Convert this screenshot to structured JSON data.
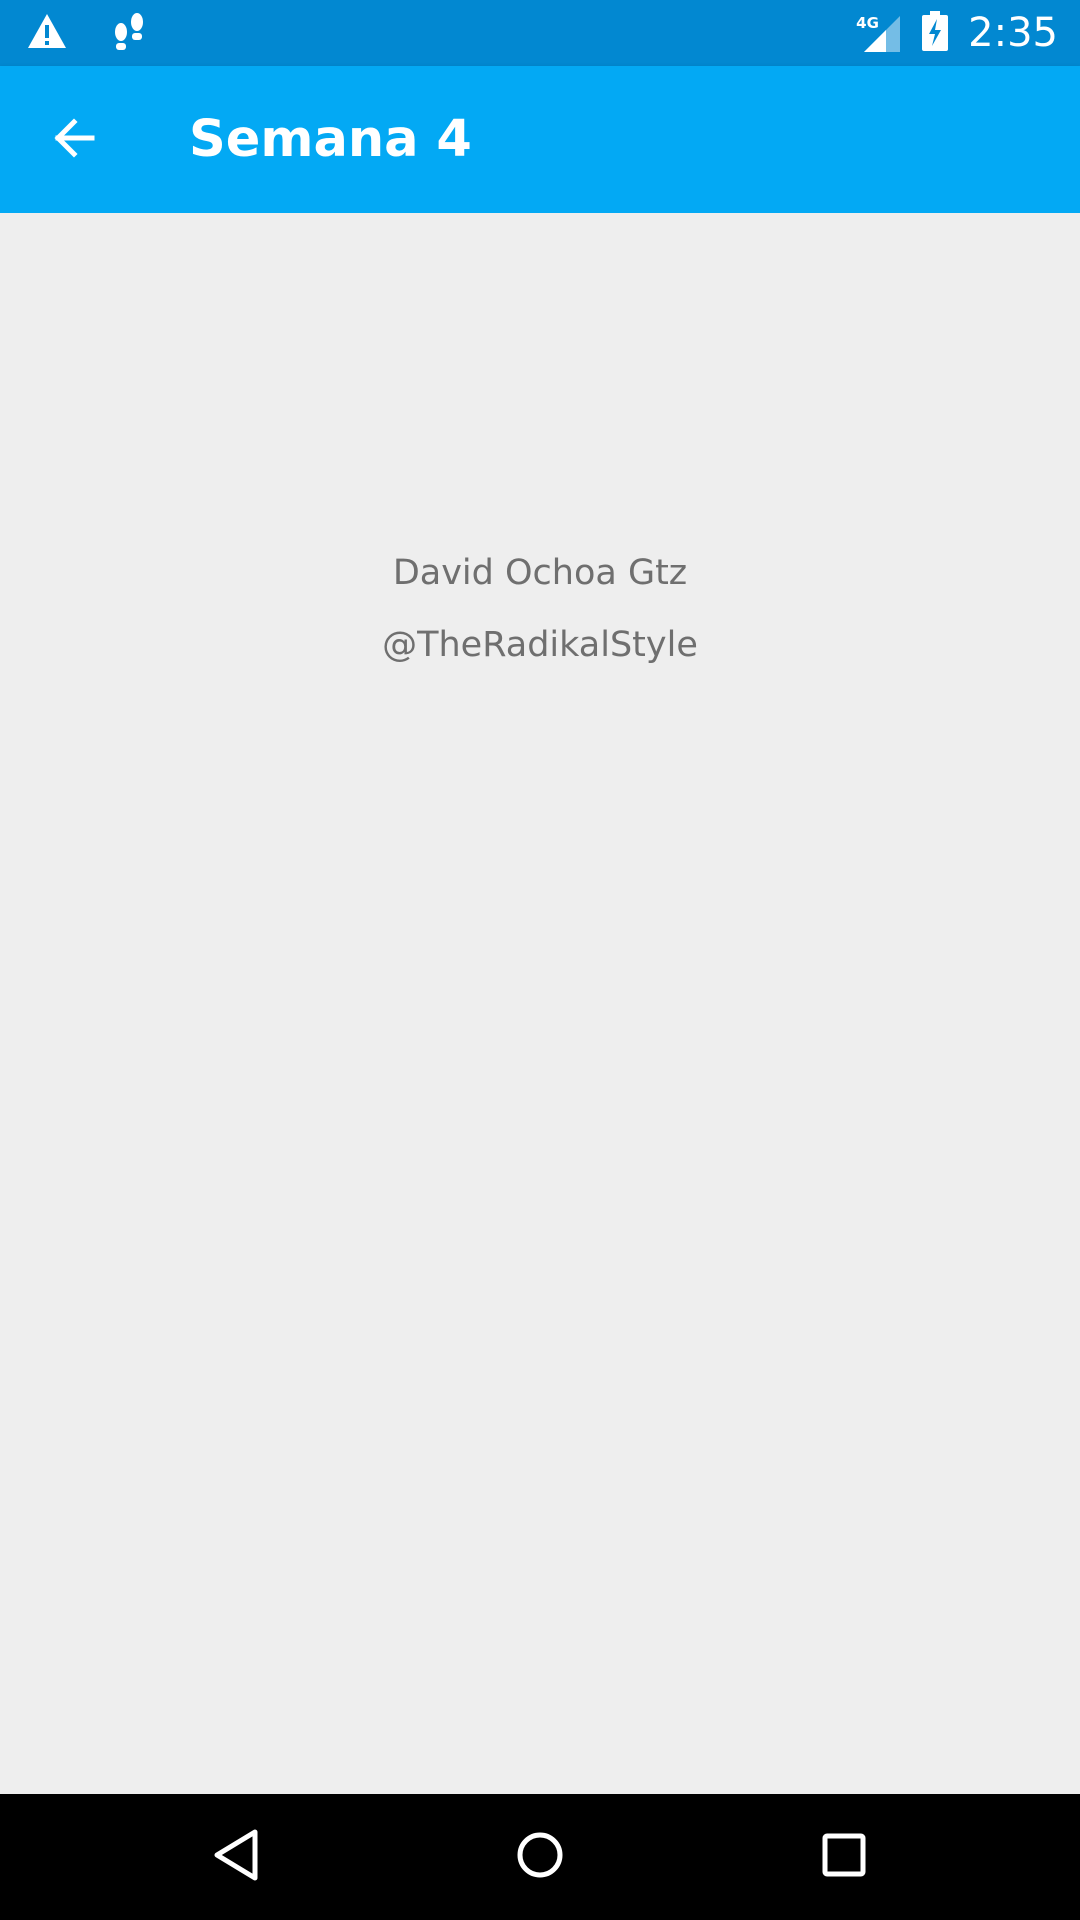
{
  "status_bar": {
    "network_type": "4G",
    "time": "2:35",
    "icons": [
      "alert-icon",
      "steps-icon",
      "signal-icon",
      "battery-charging-icon"
    ],
    "background": "#0288d1"
  },
  "app_bar": {
    "title": "Semana 4",
    "back_icon": "arrow-back-icon",
    "background": "#03a9f4"
  },
  "content": {
    "author_name": "David Ochoa Gtz",
    "author_handle": "@TheRadikalStyle",
    "text_color": "#6f6f6f",
    "background": "#eeeeee"
  },
  "nav_bar": {
    "icons": [
      "nav-back-icon",
      "nav-home-icon",
      "nav-recents-icon"
    ],
    "background": "#000000"
  }
}
